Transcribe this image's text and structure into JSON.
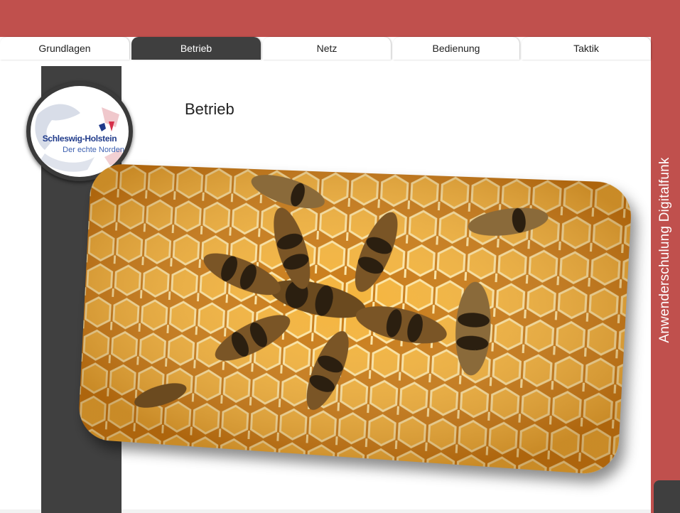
{
  "tabs": [
    {
      "label": "Grundlagen",
      "active": false
    },
    {
      "label": "Betrieb",
      "active": true
    },
    {
      "label": "Netz",
      "active": false
    },
    {
      "label": "Bedienung",
      "active": false
    },
    {
      "label": "Taktik",
      "active": false
    }
  ],
  "side_title": "Anwenderschulung Digitalfunk",
  "logo": {
    "name": "Schleswig-Holstein",
    "tagline": "Der echte Norden"
  },
  "page": {
    "title": "Betrieb"
  },
  "image": {
    "subject": "honeybees-on-honeycomb"
  },
  "colors": {
    "brand_red": "#c0504d",
    "dark": "#3f3f3f",
    "honey": "#e9a63a"
  }
}
